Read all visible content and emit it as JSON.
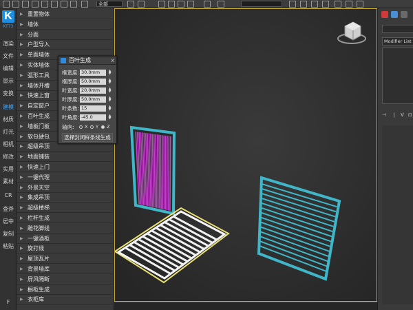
{
  "toolbar": {
    "field_value": "全部"
  },
  "leftbar": {
    "logo": "K",
    "brand": "KT73",
    "tabs": [
      {
        "label": "渲染",
        "active": false
      },
      {
        "label": "文件",
        "active": false
      },
      {
        "label": "编辑",
        "active": false
      },
      {
        "label": "显示",
        "active": false
      },
      {
        "label": "变换",
        "active": false
      },
      {
        "label": "建模",
        "active": true
      },
      {
        "label": "材质",
        "active": false
      },
      {
        "label": "灯光",
        "active": false
      },
      {
        "label": "相机",
        "active": false
      },
      {
        "label": "修改",
        "active": false
      },
      {
        "label": "实用",
        "active": false
      },
      {
        "label": "素材",
        "active": false
      },
      {
        "label": "CR",
        "active": false
      },
      {
        "label": "查斧",
        "active": false
      },
      {
        "label": "居中",
        "active": false
      },
      {
        "label": "复制",
        "active": false
      },
      {
        "label": "粘贴",
        "active": false
      },
      {
        "label": "F",
        "active": false
      }
    ]
  },
  "tools": [
    "重置物体",
    "墙体",
    "分面",
    "户型导入",
    "单面墙体",
    "实体墙体",
    "弧形工具",
    "墙体开槽",
    "快速上窗",
    "自定窗户",
    "百叶生成",
    "墙板门板",
    "软包硬包",
    "超级吊顶",
    "地面铺装",
    "快速上门",
    "一键代理",
    "外景天空",
    "集成吊顶",
    "超级楼梯",
    "栏杆生成",
    "雕花脚线",
    "一键酒柜",
    "旋打线",
    "屋顶瓦片",
    "背景墙库",
    "屏风隔断",
    "橱柜生成",
    "衣柜库"
  ],
  "dialog": {
    "title": "百叶生成",
    "close": "x",
    "params": [
      {
        "label": "框宽度:",
        "value": "30.0mm"
      },
      {
        "label": "框厚度:",
        "value": "50.0mm"
      },
      {
        "label": "叶宽度:",
        "value": "20.0mm"
      },
      {
        "label": "叶厚度:",
        "value": "50.0mm"
      },
      {
        "label": "叶条数:",
        "value": "15"
      },
      {
        "label": "叶角度:",
        "value": "-45.0"
      }
    ],
    "axis_label": "轴向:",
    "axes": [
      {
        "label": "X",
        "selected": false
      },
      {
        "label": "Y",
        "selected": false
      },
      {
        "label": "Z",
        "selected": true
      }
    ],
    "button": "选择封闭样条线生成"
  },
  "rightpanel": {
    "modifier_list": "Modifier List"
  },
  "colors": {
    "accent": "#1e8fe0",
    "louver_teal": "#3fb7c9",
    "slats_pink": "#c040c8",
    "selection_yellow": "#e8e070"
  }
}
